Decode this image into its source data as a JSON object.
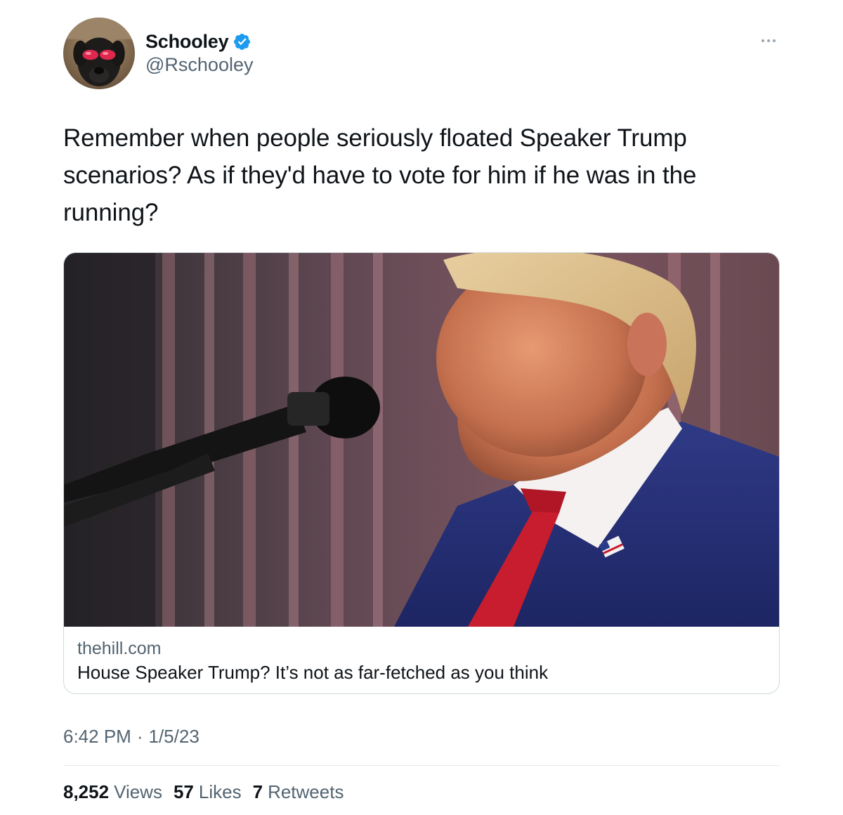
{
  "author": {
    "display_name": "Schooley",
    "handle": "@Rschooley",
    "verified": true,
    "avatar_icon": "dog-with-sunglasses-avatar"
  },
  "tweet": {
    "text": "Remember when people seriously floated Speaker Trump scenarios? As if they'd have to vote for him if he was in the running?"
  },
  "card": {
    "domain": "thehill.com",
    "title": "House Speaker Trump? It’s not as far-fetched as you think"
  },
  "timestamp": {
    "time": "6:42 PM",
    "separator": "·",
    "date": "1/5/23"
  },
  "stats": {
    "views_count": "8,252",
    "views_label": "Views",
    "likes_count": "57",
    "likes_label": "Likes",
    "retweets_count": "7",
    "retweets_label": "Retweets"
  },
  "colors": {
    "text_primary": "#0f1419",
    "text_secondary": "#536471",
    "verified_blue": "#1d9bf0",
    "border": "#cfd9de"
  }
}
